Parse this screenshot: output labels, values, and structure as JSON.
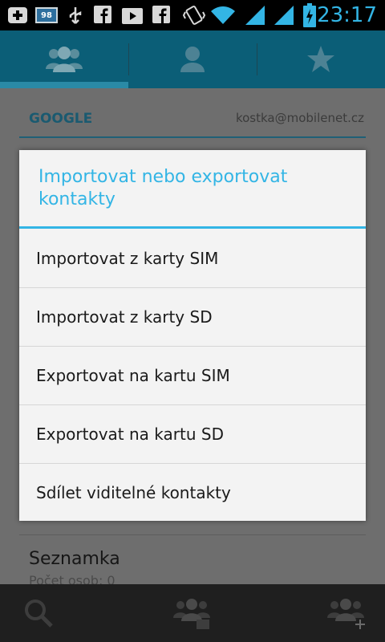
{
  "status_bar": {
    "notification_count": "98",
    "time": "23:17",
    "icons": [
      "add-icon",
      "notification-badge-icon",
      "usb-icon",
      "facebook-icon",
      "play-store-icon",
      "facebook-icon",
      "vibrate-icon",
      "wifi-icon",
      "signal-icon",
      "signal-icon",
      "battery-charging-icon"
    ]
  },
  "tabs": [
    {
      "name": "groups",
      "icon": "contacts-group-icon",
      "selected": true
    },
    {
      "name": "all-contacts",
      "icon": "person-icon",
      "selected": false
    },
    {
      "name": "favorites",
      "icon": "star-icon",
      "selected": false
    }
  ],
  "account": {
    "name": "GOOGLE",
    "email": "kostka@mobilenet.cz"
  },
  "background_group": {
    "name": "Seznamka",
    "subtitle": "Počet osob: 0"
  },
  "dialog": {
    "title": "Importovat nebo exportovat kontakty",
    "options": [
      "Importovat z karty SIM",
      "Importovat z karty SD",
      "Exportovat na kartu SIM",
      "Exportovat na kartu SD",
      "Sdílet viditelné kontakty"
    ]
  },
  "bottom_bar": {
    "icons": [
      "search-icon",
      "edit-group-icon",
      "add-group-icon"
    ]
  },
  "colors": {
    "accent": "#33b5e5",
    "tabbar": "#0b5e77",
    "dialog_bg": "#f3f3f3",
    "status_bg": "#000000"
  }
}
